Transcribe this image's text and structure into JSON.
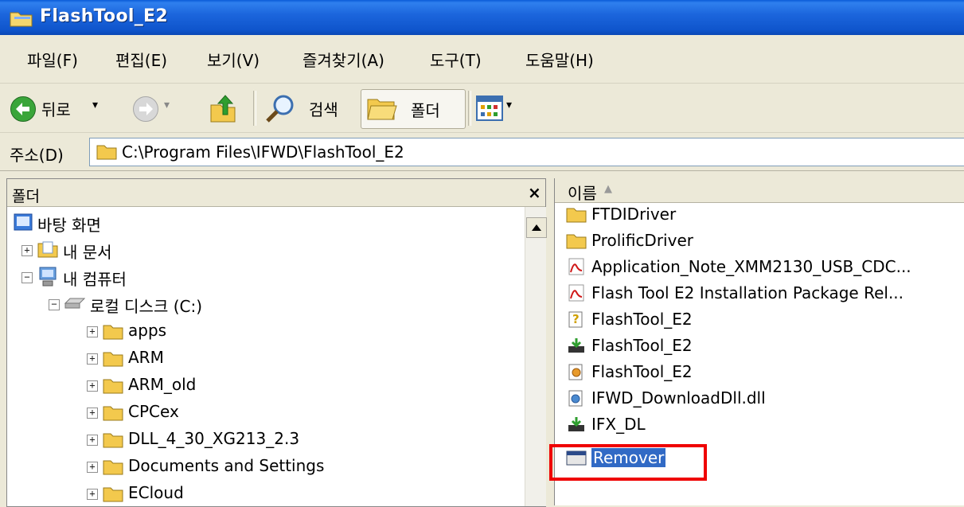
{
  "window": {
    "title": "FlashTool_E2"
  },
  "menu": [
    {
      "label": "파일(F)"
    },
    {
      "label": "편집(E)"
    },
    {
      "label": "보기(V)"
    },
    {
      "label": "즐겨찾기(A)"
    },
    {
      "label": "도구(T)"
    },
    {
      "label": "도움말(H)"
    }
  ],
  "toolbar": {
    "back_label": "뒤로",
    "search_label": "검색",
    "folders_label": "폴더"
  },
  "address": {
    "label": "주소(D)",
    "value": "C:\\Program Files\\IFWD\\FlashTool_E2"
  },
  "folder_pane": {
    "title": "폴더",
    "close_symbol": "×",
    "tree": [
      {
        "label": "바탕 화면",
        "icon": "desktop-icon",
        "level": 0,
        "expander": ""
      },
      {
        "label": "내 문서",
        "icon": "my-documents-icon",
        "level": 1,
        "expander": "+"
      },
      {
        "label": "내 컴퓨터",
        "icon": "my-computer-icon",
        "level": 1,
        "expander": "−"
      },
      {
        "label": "로컬 디스크 (C:)",
        "icon": "disk-drive-icon",
        "level": 2,
        "expander": "−"
      },
      {
        "label": "apps",
        "icon": "folder-icon",
        "level": 3,
        "expander": "+"
      },
      {
        "label": "ARM",
        "icon": "folder-icon",
        "level": 3,
        "expander": "+"
      },
      {
        "label": "ARM_old",
        "icon": "folder-icon",
        "level": 3,
        "expander": "+"
      },
      {
        "label": "CPCex",
        "icon": "folder-icon",
        "level": 3,
        "expander": "+"
      },
      {
        "label": "DLL_4_30_XG213_2.3",
        "icon": "folder-icon",
        "level": 3,
        "expander": "+"
      },
      {
        "label": "Documents and Settings",
        "icon": "folder-icon",
        "level": 3,
        "expander": "+"
      },
      {
        "label": "ECloud",
        "icon": "folder-icon",
        "level": 3,
        "expander": "+"
      }
    ]
  },
  "file_list": {
    "column_name": "이름",
    "sort_arrow": "▲",
    "files": [
      {
        "name": "FTDIDriver",
        "icon": "folder-icon"
      },
      {
        "name": "ProlificDriver",
        "icon": "folder-icon"
      },
      {
        "name": "Application_Note_XMM2130_USB_CDC...",
        "icon": "pdf-icon"
      },
      {
        "name": "Flash Tool E2 Installation Package Rel...",
        "icon": "pdf-icon"
      },
      {
        "name": "FlashTool_E2",
        "icon": "help-file-icon"
      },
      {
        "name": "FlashTool_E2",
        "icon": "application-icon"
      },
      {
        "name": "FlashTool_E2",
        "icon": "settings-file-icon"
      },
      {
        "name": "IFWD_DownloadDll.dll",
        "icon": "dll-icon"
      },
      {
        "name": "IFX_DL",
        "icon": "application-icon"
      },
      {
        "name": "Remover",
        "icon": "window-app-icon",
        "selected": true
      }
    ]
  },
  "colors": {
    "title_bar": "#0a5cd8",
    "selection": "#316ac5",
    "highlight_box": "#ef0000",
    "chrome": "#ece9d8"
  }
}
